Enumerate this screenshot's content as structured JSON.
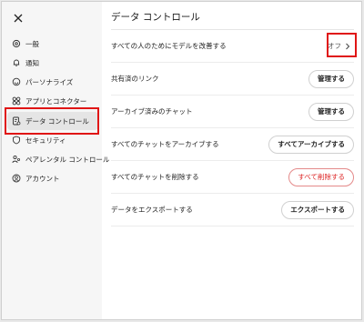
{
  "sidebar": {
    "items": [
      {
        "id": "general",
        "label": "一般",
        "icon": "gear-icon"
      },
      {
        "id": "notifications",
        "label": "通知",
        "icon": "bell-icon"
      },
      {
        "id": "personalization",
        "label": "パーソナライズ",
        "icon": "personalize-icon"
      },
      {
        "id": "apps",
        "label": "アプリとコネクター",
        "icon": "apps-icon"
      },
      {
        "id": "data-controls",
        "label": "データ コントロール",
        "icon": "data-controls-icon"
      },
      {
        "id": "security",
        "label": "セキュリティ",
        "icon": "shield-icon"
      },
      {
        "id": "parental",
        "label": "ペアレンタル コントロール",
        "icon": "parental-icon"
      },
      {
        "id": "account",
        "label": "アカウント",
        "icon": "account-icon"
      }
    ],
    "active": "data-controls"
  },
  "main": {
    "title": "データ コントロール",
    "rows": [
      {
        "label": "すべての人のためにモデルを改善する",
        "control": "toggle",
        "value": "オフ"
      },
      {
        "label": "共有済のリンク",
        "control": "button",
        "button": "管理する"
      },
      {
        "label": "アーカイブ済みのチャット",
        "control": "button",
        "button": "管理する"
      },
      {
        "label": "すべてのチャットをアーカイブする",
        "control": "button",
        "button": "すべてアーカイブする"
      },
      {
        "label": "すべてのチャットを削除する",
        "control": "button",
        "button": "すべて削除する",
        "style": "danger"
      },
      {
        "label": "データをエクスポートする",
        "control": "button",
        "button": "エクスポートする"
      }
    ]
  },
  "colors": {
    "highlight": "#e01515",
    "danger": "#dd2222",
    "sidebar_bg": "#f6f6f6",
    "active_bg": "#e5e5e5"
  }
}
